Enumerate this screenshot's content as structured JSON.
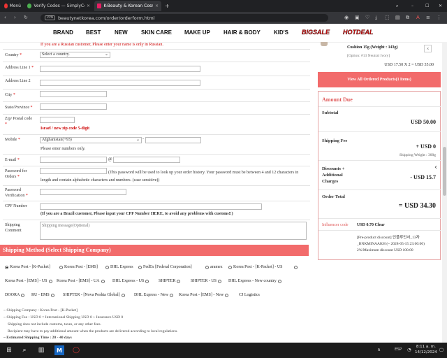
{
  "browser": {
    "tabs": [
      {
        "label": "Menú",
        "active": false
      },
      {
        "label": "Verify Codes — SimplyCod",
        "active": false
      },
      {
        "label": "K-Beauty & Korean Cosme",
        "active": true
      }
    ],
    "new_tab": "+",
    "url": "beautynetkorea.com/order/orderform.html",
    "vpn": "VPN"
  },
  "site_nav": [
    "BRAND",
    "BEST",
    "NEW",
    "SKIN CARE",
    "MAKE UP",
    "HAIR & BODY",
    "KID'S"
  ],
  "site_nav_special": [
    "BIGSALE",
    "HOTDEAL"
  ],
  "form": {
    "russian_note": "If you are a Russian customer, Please enter your name is only in Russian.",
    "country_label": "Country",
    "country_value": "Select a country.",
    "address1_label": "Address Line 1",
    "address2_label": "Address Line 2",
    "city_label": "City",
    "state_label": "State/Province",
    "zip_label": "Zip/ Postal code",
    "zip_note": "Israel / new zip code 5-digit",
    "mobile_label": "Mobile",
    "mobile_value": "Afghanistan(+93)",
    "mobile_dash": "-",
    "mobile_note": "Please enter numbers only.",
    "email_label": "E-mail",
    "email_at": "@",
    "password_label_1": "Password for",
    "password_label_2": "Orders",
    "password_note": "(This password will be used to look up your order history. Your password must be between 4 and 12 characters in length and contain alphabetic characters and numbers. (case sensitive))",
    "pwverify_label_1": "Password",
    "pwverify_label_2": "Verification",
    "cpf_label": "CPF Number",
    "cpf_note": "(If you are a Brazil customer, Please input your CPF Number HERE, to avoid any problems with customs!!)",
    "comment_label_1": "Shipping",
    "comment_label_2": "Comment",
    "comment_placeholder": "Shipping message(Optional)",
    "required_mark": "*"
  },
  "cart": {
    "item_name": "Cushion 15g (Weight : 143g)",
    "item_option": "[Option: #13 Neutral Ivory]",
    "item_price": "USD 17.50 X 2 = USD 35.00",
    "view_all": "View All Ordered Products(1 items)"
  },
  "amount_due": {
    "title": "Amount Due",
    "subtotal_label": "Subtotal",
    "subtotal_value": "USD 50.00",
    "shipping_label": "Shipping Fee",
    "shipping_value": "+ USD 0",
    "shipping_weight": "Shipping Weight : 300g",
    "discount_label_1": "Discounts +",
    "discount_label_2": "Additional",
    "discount_label_3": "Charges",
    "discount_value": "- USD 15.7",
    "total_label": "Order Total",
    "total_value": "= USD 34.30",
    "influencer_label": "Influencer code",
    "influencer_value": "USD 0.70 Clear",
    "promo_line1": "[Pre-product discount] 인플루언서_13자",
    "promo_line2": "_BNKMINAAKH (~ 2028-05-15 23:00:00)",
    "promo_line3": "2%/Maximum discount USD 100.00"
  },
  "shipping": {
    "title": "Shipping Method (Select Shipping Company)",
    "options_row1": [
      "Korea Post - [K-Packet]",
      "Korea Post - [EMS]",
      "DHL Express",
      "FedEx [Federal Corporation]",
      "aramex",
      "Korea Post - [K-Packet] - US"
    ],
    "options_row2": [
      "Korea Post - [EMS] - US",
      "Korea Post - [EMS] - UA",
      "DHL Express - US",
      "SHIPTER",
      "SHIPTER - US",
      "DHL Express - New country"
    ],
    "options_row3": [
      "DOORA",
      "RU - EMS",
      "SHIPTER - [Nova Poshta Global]",
      "DHL Express - New",
      "Korea Post - [EMS] - New",
      "CJ Logistics"
    ],
    "selected": "Korea Post - [K-Packet]",
    "info_company": "~ Shipping Company : Korea Post - [K-Packet]",
    "info_fee": "~ Shipping Fee : USD 0 = International Shipping USD 0 + Insurance USD 0",
    "info_note1": "Shipping does not include customs, taxes, or any other fees.",
    "info_note2": "Recipient may have to pay additional amount when the products are delivered according to local regulations.",
    "info_time": "~ Estimated Shipping Time : 20 - 40 days"
  },
  "taskbar": {
    "lang": "ESP",
    "time": "8:11 a. m.",
    "date": "14/12/2024"
  },
  "colors": {
    "accent": "#f26b6b",
    "amount_title": "#e05a5a",
    "chrome_dark": "#202124"
  }
}
